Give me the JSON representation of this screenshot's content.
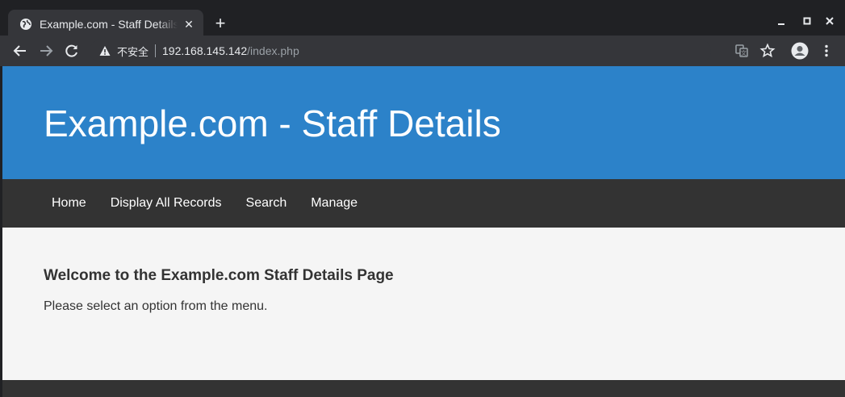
{
  "browser": {
    "tab": {
      "title": "Example.com - Staff Details"
    },
    "address": {
      "security_label": "不安全",
      "host": "192.168.145.142",
      "path": "/index.php"
    },
    "icons": {
      "tab_favicon": "globe-icon",
      "close": "close-icon",
      "new_tab": "plus-icon",
      "minimize": "minimize-icon",
      "maximize": "maximize-icon",
      "window_close": "window-close-icon",
      "back": "back-arrow-icon",
      "forward": "forward-arrow-icon",
      "reload": "reload-icon",
      "warning": "warning-icon",
      "translate": "translate-icon",
      "bookmark": "star-icon",
      "profile": "profile-icon",
      "menu": "kebab-menu-icon"
    }
  },
  "site": {
    "header_title": "Example.com - Staff Details",
    "nav": [
      {
        "label": "Home"
      },
      {
        "label": "Display All Records"
      },
      {
        "label": "Search"
      },
      {
        "label": "Manage"
      }
    ],
    "welcome_heading": "Welcome to the Example.com Staff Details Page",
    "welcome_text": "Please select an option from the menu."
  },
  "colors": {
    "hero_bg": "#2c82c9",
    "nav_bg": "#333333",
    "page_bg": "#f5f5f5",
    "browser_dark": "#202124",
    "toolbar": "#35363a"
  }
}
